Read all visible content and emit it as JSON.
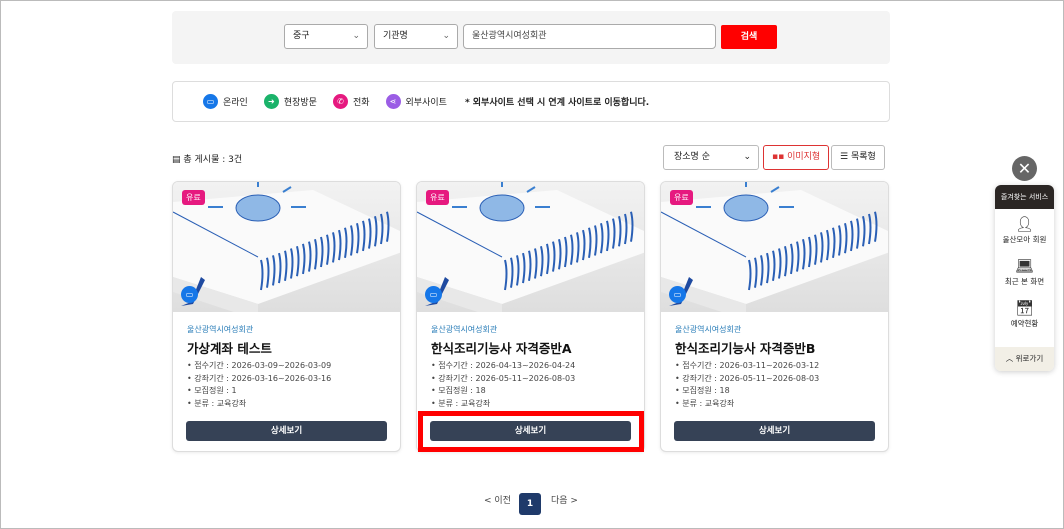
{
  "search": {
    "district": "중구",
    "type": "기관명",
    "query": "울산광역시여성회관",
    "button": "검색"
  },
  "legend": {
    "items": [
      {
        "label": "온라인",
        "icon": "monitor-icon",
        "color": "#1677e8"
      },
      {
        "label": "현장방문",
        "icon": "arrow-icon",
        "color": "#1bb36a"
      },
      {
        "label": "전화",
        "icon": "phone-icon",
        "color": "#e6197f"
      },
      {
        "label": "외부사이트",
        "icon": "share-icon",
        "color": "#9b5de5"
      }
    ],
    "note": "* 외부사이트 선택 시 연계 사이트로 이동합니다."
  },
  "list": {
    "total": "총 게시물 : 3건",
    "sort": "장소명 순",
    "view_image": "이미지형",
    "view_list": "목록형"
  },
  "cards": [
    {
      "badge": "유료",
      "org": "울산광역시여성회관",
      "title": "가상계좌 테스트",
      "info": [
        "접수기간 : 2026-03-09~2026-03-09",
        "강좌기간 : 2026-03-16~2026-03-16",
        "모집정원 : 1",
        "분류 : 교육강좌"
      ],
      "button": "상세보기"
    },
    {
      "badge": "유료",
      "org": "울산광역시여성회관",
      "title": "한식조리기능사 자격증반A",
      "info": [
        "접수기간 : 2026-04-13~2026-04-24",
        "강좌기간 : 2026-05-11~2026-08-03",
        "모집정원 : 18",
        "분류 : 교육강좌"
      ],
      "button": "상세보기"
    },
    {
      "badge": "유료",
      "org": "울산광역시여성회관",
      "title": "한식조리기능사 자격증반B",
      "info": [
        "접수기간 : 2026-03-11~2026-03-12",
        "강좌기간 : 2026-05-11~2026-08-03",
        "모집정원 : 18",
        "분류 : 교육강좌"
      ],
      "button": "상세보기"
    }
  ],
  "pagination": {
    "prev": "< 이전",
    "current": "1",
    "next": "다음 >"
  },
  "quick": {
    "title": "즐겨찾는 서비스",
    "items": [
      "울산모아 회원",
      "최근 본 화면",
      "예약현황"
    ],
    "top": "위로가기"
  }
}
